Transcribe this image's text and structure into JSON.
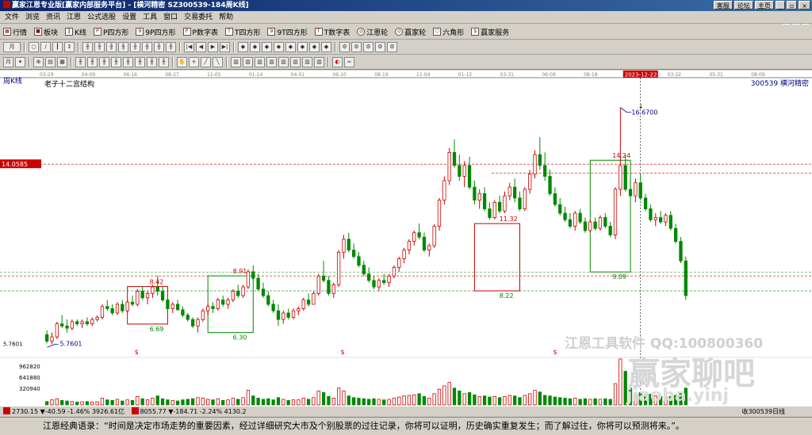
{
  "window": {
    "title": "赢家江恩专业版[赢家内部服务平台] - [横河精密  SZ300539-184周K线]",
    "buttons": [
      "客服",
      "论坛",
      "主页"
    ]
  },
  "menu": [
    "文件",
    "浏览",
    "资讯",
    "江恩",
    "公式选股",
    "设置",
    "工具",
    "窗口",
    "交易委托",
    "帮助"
  ],
  "toolbar1": [
    {
      "icon": "grid-icon",
      "label": "行情"
    },
    {
      "icon": "block-icon",
      "label": "板块"
    },
    {
      "icon": "kline-icon",
      "label": "K线"
    },
    {
      "icon": "p-square-icon",
      "label": "P四方形"
    },
    {
      "icon": "9p-square-icon",
      "label": "9P四方形"
    },
    {
      "icon": "p-number-icon",
      "label": "P数字表"
    },
    {
      "icon": "t-square-icon",
      "label": "T四方形"
    },
    {
      "icon": "9t-square-icon",
      "label": "9T四方形"
    },
    {
      "icon": "t-number-icon",
      "label": "T数字表"
    },
    {
      "icon": "gann-wheel-icon",
      "label": "江恩轮"
    },
    {
      "icon": "winner-wheel-icon",
      "label": "赢家轮"
    },
    {
      "icon": "hexagon-icon",
      "label": "六角形"
    },
    {
      "icon": "service-icon",
      "label": "赢家服务"
    }
  ],
  "toolbar2": {
    "period_label": "月"
  },
  "chart": {
    "period_label": "周K线",
    "subtitle": "老子十二宫结构",
    "stock_label": "300539  横河精密",
    "price_marker": "14.0585",
    "date_cursor": "2023-12-22",
    "peak_label": "16.6700",
    "low_label": "5.7601",
    "dollar_marker": "$",
    "watermark_text": "江恩工具软件  QQ:100800360",
    "watermark_logo": "赢家聊吧",
    "watermark_url": "jiaoba.yinj",
    "top_dates": [
      "03-29",
      "04-09",
      "06-16",
      "08-27",
      "11-05",
      "01-14",
      "04-01",
      "06-10",
      "08-19",
      "11-04",
      "01-12",
      "03-31",
      "06-09",
      "08-18",
      "11-03",
      "03-22",
      "05-31",
      "08-09"
    ],
    "boxes": [
      {
        "top": "8.42",
        "bottom": "6.69"
      },
      {
        "top": "8.91",
        "bottom": "6.30"
      },
      {
        "top": "11.32",
        "bottom": "8.22"
      },
      {
        "top": "14.24",
        "bottom": "9.09"
      }
    ],
    "vol_ticks": [
      "962820",
      "641880",
      "320940"
    ],
    "price_ticks": [
      "5.7601"
    ]
  },
  "status": {
    "sh": "2730.15 ▼-40.59 -1.46% 3926.61亿",
    "sz": "8055.77 ▼-184.71 -2.24% 4130.2",
    "right": "收300539日线"
  },
  "quote": "江恩经典语录：“时间是决定市场走势的重要因素，经过详细研究大市及个别股票的过往记录，你将可以证明，历史确实重复发生；而了解过往，你将可以预测将来。”。",
  "colors": {
    "up": "#cc0000",
    "down": "#008800",
    "title_bar": "#0a246a",
    "level_red": "#cc0000",
    "level_green": "#008800",
    "cursor_label": "#cc0000"
  },
  "chart_data": {
    "type": "candlestick",
    "title": "老子十二宫结构",
    "ohlc": [
      [
        6.2,
        6.4,
        5.8,
        5.9
      ],
      [
        5.9,
        6.3,
        5.76,
        6.1
      ],
      [
        6.1,
        6.8,
        6.0,
        6.7
      ],
      [
        6.7,
        7.1,
        6.5,
        6.6
      ],
      [
        6.6,
        6.9,
        6.3,
        6.5
      ],
      [
        6.5,
        6.9,
        6.4,
        6.8
      ],
      [
        6.8,
        6.9,
        6.6,
        6.7
      ],
      [
        6.7,
        6.9,
        6.5,
        6.8
      ],
      [
        6.8,
        7.0,
        6.6,
        6.7
      ],
      [
        6.7,
        7.0,
        6.6,
        6.9
      ],
      [
        6.9,
        7.1,
        6.8,
        7.0
      ],
      [
        7.0,
        7.6,
        6.9,
        7.5
      ],
      [
        7.5,
        7.8,
        7.3,
        7.4
      ],
      [
        7.4,
        7.6,
        7.1,
        7.2
      ],
      [
        7.2,
        7.7,
        7.1,
        7.6
      ],
      [
        7.6,
        7.8,
        7.2,
        7.3
      ],
      [
        7.3,
        7.8,
        7.2,
        7.7
      ],
      [
        7.7,
        8.0,
        7.5,
        7.6
      ],
      [
        7.6,
        8.3,
        7.5,
        8.2
      ],
      [
        8.2,
        8.42,
        7.8,
        7.9
      ],
      [
        7.9,
        8.2,
        7.6,
        8.1
      ],
      [
        8.1,
        8.5,
        7.9,
        8.4
      ],
      [
        8.4,
        8.91,
        8.0,
        8.2
      ],
      [
        8.2,
        8.4,
        7.7,
        7.8
      ],
      [
        7.8,
        8.0,
        7.3,
        7.4
      ],
      [
        7.4,
        7.7,
        7.2,
        7.6
      ],
      [
        7.6,
        7.8,
        7.3,
        7.35
      ],
      [
        7.35,
        7.5,
        7.0,
        7.1
      ],
      [
        7.1,
        7.2,
        6.8,
        6.9
      ],
      [
        6.9,
        7.0,
        6.5,
        6.6
      ],
      [
        6.6,
        7.0,
        6.3,
        6.9
      ],
      [
        6.9,
        7.4,
        6.8,
        7.3
      ],
      [
        7.3,
        7.6,
        7.1,
        7.5
      ],
      [
        7.5,
        7.7,
        7.2,
        7.4
      ],
      [
        7.4,
        7.9,
        7.3,
        7.8
      ],
      [
        7.8,
        8.0,
        7.5,
        7.6
      ],
      [
        7.6,
        7.9,
        7.4,
        7.8
      ],
      [
        7.8,
        8.3,
        7.7,
        8.2
      ],
      [
        8.2,
        8.5,
        7.9,
        8.0
      ],
      [
        8.0,
        8.5,
        7.9,
        8.4
      ],
      [
        8.4,
        9.2,
        8.3,
        9.1
      ],
      [
        9.1,
        9.4,
        8.7,
        8.8
      ],
      [
        8.8,
        9.0,
        8.2,
        8.3
      ],
      [
        8.3,
        8.6,
        7.9,
        8.0
      ],
      [
        8.0,
        8.2,
        7.5,
        7.6
      ],
      [
        7.6,
        7.8,
        7.2,
        7.3
      ],
      [
        7.3,
        7.6,
        6.6,
        6.9
      ],
      [
        6.9,
        7.3,
        6.7,
        7.2
      ],
      [
        7.2,
        7.4,
        6.9,
        7.0
      ],
      [
        7.0,
        7.4,
        6.9,
        7.3
      ],
      [
        7.3,
        7.5,
        7.1,
        7.4
      ],
      [
        7.4,
        7.9,
        7.3,
        7.8
      ],
      [
        7.8,
        8.1,
        7.5,
        7.6
      ],
      [
        7.6,
        8.2,
        7.6,
        8.1
      ],
      [
        8.1,
        9.0,
        8.0,
        8.9
      ],
      [
        8.9,
        9.6,
        8.6,
        8.7
      ],
      [
        8.7,
        8.9,
        8.0,
        8.1
      ],
      [
        8.1,
        8.6,
        7.9,
        8.5
      ],
      [
        8.5,
        10.1,
        8.4,
        10.0
      ],
      [
        10.0,
        10.8,
        9.7,
        10.6
      ],
      [
        10.6,
        10.9,
        10.0,
        10.1
      ],
      [
        10.1,
        10.4,
        9.7,
        9.8
      ],
      [
        9.8,
        10.0,
        9.3,
        9.4
      ],
      [
        9.4,
        9.6,
        8.9,
        9.0
      ],
      [
        9.0,
        9.3,
        8.6,
        8.7
      ],
      [
        8.7,
        8.9,
        8.3,
        8.4
      ],
      [
        8.4,
        8.8,
        8.2,
        8.7
      ],
      [
        8.7,
        9.0,
        8.5,
        8.6
      ],
      [
        8.6,
        9.0,
        8.4,
        8.9
      ],
      [
        8.9,
        9.4,
        8.8,
        9.3
      ],
      [
        9.3,
        9.8,
        9.1,
        9.7
      ],
      [
        9.7,
        10.2,
        9.5,
        10.1
      ],
      [
        10.1,
        10.6,
        9.9,
        10.5
      ],
      [
        10.5,
        11.0,
        10.3,
        10.9
      ],
      [
        10.9,
        11.32,
        10.6,
        10.7
      ],
      [
        10.7,
        10.9,
        10.0,
        10.1
      ],
      [
        10.1,
        10.4,
        9.8,
        10.3
      ],
      [
        10.3,
        11.3,
        10.2,
        11.2
      ],
      [
        11.2,
        12.5,
        11.0,
        12.4
      ],
      [
        12.4,
        13.5,
        12.2,
        13.3
      ],
      [
        13.3,
        14.8,
        13.1,
        14.6
      ],
      [
        14.6,
        15.2,
        13.9,
        14.0
      ],
      [
        14.0,
        14.5,
        13.3,
        13.5
      ],
      [
        13.5,
        14.2,
        13.0,
        14.0
      ],
      [
        14.0,
        14.4,
        12.9,
        13.0
      ],
      [
        13.0,
        13.3,
        12.2,
        12.4
      ],
      [
        12.4,
        12.9,
        12.0,
        12.7
      ],
      [
        12.7,
        13.0,
        11.9,
        12.0
      ],
      [
        12.0,
        12.3,
        11.5,
        11.6
      ],
      [
        11.6,
        12.4,
        11.5,
        12.3
      ],
      [
        12.3,
        12.6,
        11.8,
        11.9
      ],
      [
        11.9,
        12.8,
        11.8,
        12.6
      ],
      [
        12.6,
        13.2,
        12.4,
        13.0
      ],
      [
        13.0,
        13.4,
        12.3,
        12.5
      ],
      [
        12.5,
        12.8,
        11.9,
        12.0
      ],
      [
        12.0,
        13.0,
        11.9,
        12.9
      ],
      [
        12.9,
        13.8,
        12.7,
        13.6
      ],
      [
        13.6,
        14.7,
        13.4,
        14.5
      ],
      [
        14.5,
        15.3,
        13.8,
        14.0
      ],
      [
        14.0,
        14.6,
        13.3,
        13.5
      ],
      [
        13.5,
        13.8,
        12.6,
        12.7
      ],
      [
        12.7,
        13.0,
        12.1,
        12.2
      ],
      [
        12.2,
        12.5,
        11.7,
        11.8
      ],
      [
        11.8,
        12.1,
        11.4,
        11.5
      ],
      [
        11.5,
        11.8,
        11.1,
        11.2
      ],
      [
        11.2,
        11.9,
        11.0,
        11.8
      ],
      [
        11.8,
        12.0,
        11.3,
        11.4
      ],
      [
        11.4,
        11.6,
        10.9,
        11.0
      ],
      [
        11.0,
        11.5,
        10.9,
        11.4
      ],
      [
        11.4,
        11.6,
        11.0,
        11.1
      ],
      [
        11.1,
        11.7,
        11.0,
        11.6
      ],
      [
        11.6,
        11.8,
        11.1,
        11.2
      ],
      [
        11.2,
        11.4,
        10.7,
        10.8
      ],
      [
        10.8,
        13.0,
        10.6,
        12.9
      ],
      [
        12.9,
        16.67,
        12.6,
        14.0
      ],
      [
        14.0,
        14.5,
        12.8,
        12.9
      ],
      [
        12.9,
        13.3,
        12.5,
        12.6
      ],
      [
        12.6,
        13.4,
        12.3,
        13.2
      ],
      [
        13.2,
        13.6,
        12.4,
        12.5
      ],
      [
        12.5,
        12.7,
        11.9,
        12.0
      ],
      [
        12.0,
        12.2,
        11.4,
        11.5
      ],
      [
        11.5,
        11.8,
        11.2,
        11.6
      ],
      [
        11.6,
        11.9,
        11.3,
        11.4
      ],
      [
        11.4,
        11.8,
        11.2,
        11.7
      ],
      [
        11.7,
        11.9,
        11.0,
        11.1
      ],
      [
        11.1,
        11.3,
        10.4,
        10.5
      ],
      [
        10.5,
        10.7,
        9.5,
        9.6
      ],
      [
        9.6,
        9.8,
        7.8,
        8.0
      ]
    ],
    "volume": [
      60,
      90,
      110,
      80,
      70,
      60,
      50,
      55,
      60,
      50,
      55,
      120,
      90,
      80,
      100,
      70,
      90,
      80,
      150,
      110,
      90,
      120,
      160,
      110,
      90,
      80,
      70,
      90,
      100,
      110,
      130,
      120,
      100,
      90,
      110,
      80,
      90,
      120,
      100,
      130,
      260,
      160,
      120,
      100,
      110,
      90,
      130,
      100,
      80,
      90,
      90,
      120,
      100,
      130,
      250,
      220,
      150,
      120,
      300,
      250,
      160,
      130,
      120,
      110,
      100,
      110,
      100,
      90,
      100,
      120,
      140,
      160,
      170,
      180,
      200,
      150,
      120,
      200,
      280,
      340,
      400,
      300,
      250,
      200,
      220,
      180,
      150,
      160,
      140,
      150,
      130,
      150,
      170,
      160,
      130,
      170,
      200,
      260,
      230,
      170,
      160,
      140,
      130,
      120,
      110,
      120,
      100,
      110,
      100,
      110,
      100,
      110,
      100,
      380,
      820,
      600,
      300,
      200,
      220,
      180,
      190,
      160,
      150,
      140,
      150,
      170,
      220,
      300
    ],
    "levels": [
      {
        "value": 14.0585,
        "color": "#cc0000",
        "label": "14.0585"
      },
      {
        "value": 8.91,
        "color": "#cc0000",
        "label": "8.91"
      },
      {
        "value": 8.22,
        "color": "#008800",
        "label": "8.22"
      },
      {
        "value": 9.09,
        "color": "#008800",
        "label": "9.09"
      }
    ],
    "ylim": [
      5.3,
      17.5
    ],
    "x_labels": [
      "03-29",
      "04-09",
      "06-16",
      "08-27",
      "11-05",
      "01-14",
      "04-01",
      "06-10",
      "08-19",
      "11-04",
      "01-12",
      "03-31",
      "06-09",
      "08-18",
      "11-03",
      "03-22",
      "05-31",
      "08-09"
    ]
  }
}
